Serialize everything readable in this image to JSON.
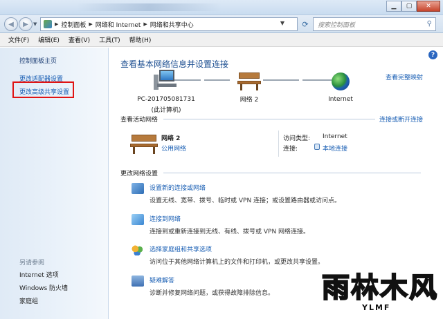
{
  "address": {
    "breadcrumbs": [
      "控制面板",
      "网络和 Internet",
      "网络和共享中心"
    ],
    "search_placeholder": "搜索控制面板"
  },
  "menu": [
    "文件(F)",
    "编辑(E)",
    "查看(V)",
    "工具(T)",
    "帮助(H)"
  ],
  "sidebar": {
    "home": "控制面板主页",
    "items": [
      "更改适配器设置",
      "更改高级共享设置"
    ],
    "see_also_label": "另请参阅",
    "see_also": [
      "Internet 选项",
      "Windows 防火墙",
      "家庭组"
    ]
  },
  "main": {
    "title": "查看基本网络信息并设置连接",
    "see_full_map": "查看完整映射",
    "map": {
      "computer_name": "PC-201705081731",
      "computer_sub": "(此计算机)",
      "network": "网络  2",
      "internet": "Internet"
    },
    "active_networks": {
      "heading": "查看活动网络",
      "connect_disconnect": "连接或断开连接",
      "network_name": "网络  2",
      "network_type": "公用网络",
      "access_type_label": "访问类型:",
      "access_type_value": "Internet",
      "connection_label": "连接:",
      "connection_value": "本地连接"
    },
    "change_settings": {
      "heading": "更改网络设置",
      "tasks": [
        {
          "icon": "network-setup-icon",
          "link": "设置新的连接或网络",
          "desc": "设置无线、宽带、拨号、临时或 VPN 连接；或设置路由器或访问点。"
        },
        {
          "icon": "connect-network-icon",
          "link": "连接到网络",
          "desc": "连接到或重新连接到无线、有线、拨号或 VPN 网络连接。"
        },
        {
          "icon": "homegroup-icon",
          "link": "选择家庭组和共享选项",
          "desc": "访问位于其他网络计算机上的文件和打印机，或更改共享设置。"
        },
        {
          "icon": "troubleshoot-icon",
          "link": "疑难解答",
          "desc": "诊断并修复网络问题，或获得故障排除信息。"
        }
      ]
    }
  },
  "watermark": {
    "glyphs": "雨林木风",
    "sub": "YLMF"
  }
}
